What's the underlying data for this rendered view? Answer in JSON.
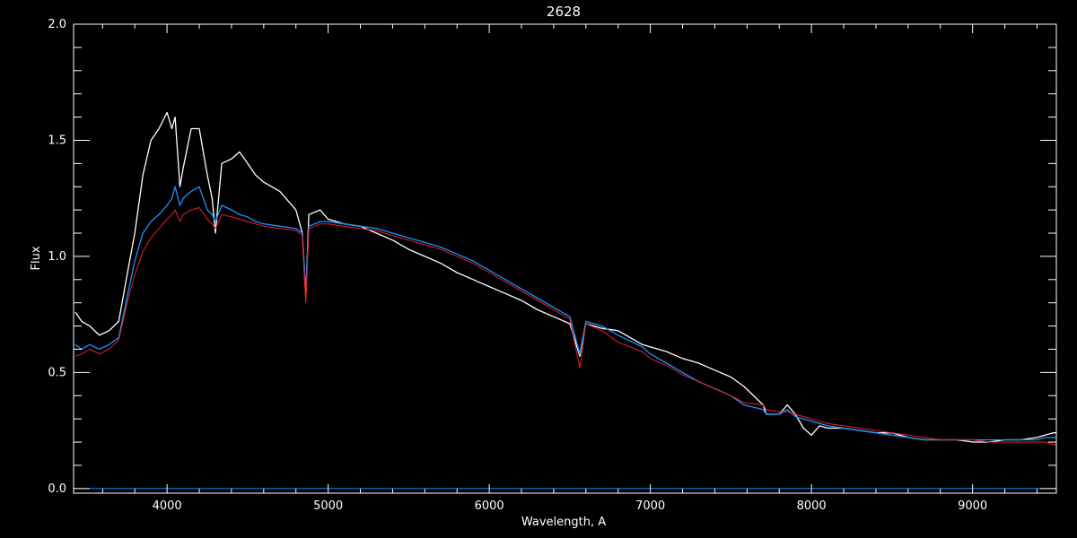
{
  "chart_data": {
    "type": "line",
    "title": "2628",
    "xlabel": "Wavelength, A",
    "ylabel": "Flux",
    "xlim": [
      3420,
      9520
    ],
    "ylim": [
      -0.02,
      2.0
    ],
    "x_ticks": [
      4000,
      5000,
      6000,
      7000,
      8000,
      9000
    ],
    "x_minor_step": 200,
    "y_ticks": [
      0.0,
      0.5,
      1.0,
      1.5,
      2.0
    ],
    "y_tick_labels": [
      "0.0",
      "0.5",
      "1.0",
      "1.5",
      "2.0"
    ],
    "y_minor_step": 0.1,
    "grid": false,
    "background": "#000000",
    "axis_color": "#ffffff",
    "series": [
      {
        "color": "#ffffff",
        "x": [
          3430,
          3470,
          3520,
          3580,
          3640,
          3700,
          3760,
          3800,
          3850,
          3900,
          3950,
          4000,
          4030,
          4050,
          4080,
          4100,
          4150,
          4200,
          4250,
          4280,
          4300,
          4340,
          4400,
          4450,
          4500,
          4550,
          4600,
          4700,
          4800,
          4840,
          4861,
          4880,
          4950,
          5000,
          5100,
          5200,
          5300,
          5400,
          5500,
          5600,
          5700,
          5800,
          5900,
          6000,
          6100,
          6200,
          6300,
          6400,
          6500,
          6562,
          6600,
          6700,
          6800,
          6950,
          7000,
          7100,
          7200,
          7300,
          7400,
          7500,
          7580,
          7700,
          7720,
          7800,
          7850,
          7900,
          7950,
          8000,
          8050,
          8100,
          8200,
          8300,
          8400,
          8500,
          8600,
          8700,
          8800,
          8900,
          9000,
          9100,
          9200,
          9300,
          9400,
          9450,
          9500,
          9520
        ],
        "y": [
          0.76,
          0.72,
          0.7,
          0.66,
          0.68,
          0.72,
          0.95,
          1.1,
          1.35,
          1.5,
          1.55,
          1.62,
          1.55,
          1.6,
          1.3,
          1.38,
          1.55,
          1.55,
          1.35,
          1.25,
          1.1,
          1.4,
          1.42,
          1.45,
          1.4,
          1.35,
          1.32,
          1.28,
          1.2,
          1.1,
          0.82,
          1.18,
          1.2,
          1.16,
          1.14,
          1.13,
          1.1,
          1.07,
          1.03,
          1.0,
          0.97,
          0.93,
          0.9,
          0.87,
          0.84,
          0.81,
          0.77,
          0.74,
          0.71,
          0.57,
          0.71,
          0.69,
          0.68,
          0.62,
          0.61,
          0.59,
          0.56,
          0.54,
          0.51,
          0.48,
          0.44,
          0.36,
          0.32,
          0.32,
          0.36,
          0.32,
          0.26,
          0.23,
          0.27,
          0.26,
          0.26,
          0.25,
          0.24,
          0.24,
          0.22,
          0.21,
          0.21,
          0.21,
          0.2,
          0.2,
          0.21,
          0.21,
          0.22,
          0.23,
          0.24,
          0.24
        ]
      },
      {
        "color": "#1e90ff",
        "x": [
          3430,
          3470,
          3520,
          3580,
          3640,
          3700,
          3760,
          3800,
          3850,
          3900,
          3950,
          4000,
          4030,
          4050,
          4080,
          4100,
          4150,
          4200,
          4250,
          4280,
          4300,
          4340,
          4400,
          4450,
          4500,
          4550,
          4600,
          4700,
          4800,
          4840,
          4861,
          4880,
          4950,
          5000,
          5100,
          5200,
          5300,
          5400,
          5500,
          5600,
          5700,
          5800,
          5900,
          6000,
          6100,
          6200,
          6300,
          6400,
          6500,
          6562,
          6600,
          6700,
          6800,
          6950,
          7000,
          7100,
          7200,
          7300,
          7400,
          7500,
          7580,
          7700,
          7720,
          7800,
          7850,
          7900,
          7950,
          8000,
          8050,
          8100,
          8200,
          8300,
          8400,
          8500,
          8600,
          8700,
          8800,
          8900,
          9000,
          9100,
          9200,
          9300,
          9400,
          9450,
          9500,
          9520
        ],
        "y": [
          0.62,
          0.6,
          0.62,
          0.6,
          0.62,
          0.65,
          0.85,
          0.98,
          1.1,
          1.15,
          1.18,
          1.22,
          1.25,
          1.3,
          1.22,
          1.25,
          1.28,
          1.3,
          1.2,
          1.18,
          1.15,
          1.22,
          1.2,
          1.18,
          1.17,
          1.15,
          1.14,
          1.13,
          1.12,
          1.1,
          0.85,
          1.13,
          1.15,
          1.15,
          1.14,
          1.13,
          1.12,
          1.1,
          1.08,
          1.06,
          1.04,
          1.01,
          0.98,
          0.94,
          0.9,
          0.86,
          0.82,
          0.78,
          0.74,
          0.58,
          0.72,
          0.7,
          0.66,
          0.61,
          0.58,
          0.54,
          0.5,
          0.46,
          0.43,
          0.4,
          0.36,
          0.34,
          0.32,
          0.32,
          0.34,
          0.31,
          0.3,
          0.29,
          0.28,
          0.27,
          0.26,
          0.25,
          0.24,
          0.23,
          0.22,
          0.21,
          0.21,
          0.21,
          0.21,
          0.21,
          0.21,
          0.21,
          0.21,
          0.22,
          0.22,
          0.22
        ]
      },
      {
        "color": "#e8202a",
        "x": [
          3430,
          3470,
          3520,
          3580,
          3640,
          3700,
          3760,
          3800,
          3850,
          3900,
          3950,
          4000,
          4030,
          4050,
          4080,
          4100,
          4150,
          4200,
          4250,
          4280,
          4300,
          4340,
          4400,
          4450,
          4500,
          4550,
          4600,
          4700,
          4800,
          4840,
          4861,
          4880,
          4950,
          5000,
          5100,
          5200,
          5300,
          5400,
          5500,
          5600,
          5700,
          5800,
          5900,
          6000,
          6100,
          6200,
          6300,
          6400,
          6500,
          6562,
          6600,
          6700,
          6800,
          6950,
          7000,
          7100,
          7200,
          7300,
          7400,
          7500,
          7580,
          7700,
          7720,
          7800,
          7850,
          7900,
          7950,
          8000,
          8050,
          8100,
          8200,
          8300,
          8400,
          8500,
          8600,
          8700,
          8800,
          8900,
          9000,
          9100,
          9200,
          9300,
          9400,
          9450,
          9500,
          9520
        ],
        "y": [
          0.57,
          0.58,
          0.6,
          0.58,
          0.6,
          0.64,
          0.82,
          0.92,
          1.02,
          1.08,
          1.12,
          1.16,
          1.18,
          1.2,
          1.15,
          1.18,
          1.2,
          1.21,
          1.16,
          1.14,
          1.12,
          1.18,
          1.17,
          1.16,
          1.15,
          1.14,
          1.13,
          1.12,
          1.11,
          1.09,
          0.8,
          1.12,
          1.14,
          1.14,
          1.13,
          1.12,
          1.11,
          1.09,
          1.07,
          1.05,
          1.03,
          1.0,
          0.97,
          0.93,
          0.89,
          0.85,
          0.81,
          0.77,
          0.73,
          0.52,
          0.71,
          0.68,
          0.63,
          0.59,
          0.56,
          0.53,
          0.49,
          0.46,
          0.43,
          0.4,
          0.37,
          0.36,
          0.34,
          0.33,
          0.33,
          0.32,
          0.31,
          0.3,
          0.29,
          0.28,
          0.27,
          0.26,
          0.25,
          0.24,
          0.23,
          0.22,
          0.21,
          0.21,
          0.21,
          0.2,
          0.2,
          0.2,
          0.2,
          0.2,
          0.19,
          0.19
        ]
      }
    ]
  }
}
